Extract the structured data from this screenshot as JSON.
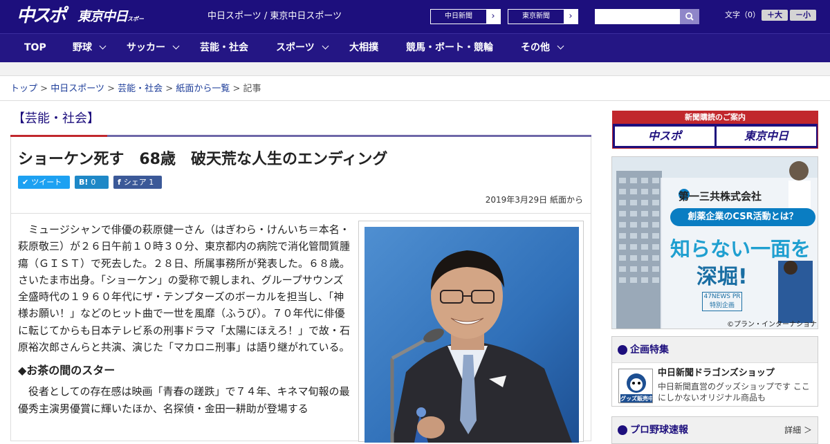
{
  "header": {
    "logo_chuspo": "中スポ",
    "logo_tokyo": "東京中日",
    "logo_tokyo_small": "スポーツ",
    "site_names": "中日スポーツ / 東京中日スポーツ",
    "link_chunichi": "中日新聞",
    "link_tokyo": "東京新聞",
    "fontsize_label": "文字（0）",
    "font_larger": "＋大",
    "font_smaller": "－小",
    "brand_color": "#1d0f7d"
  },
  "nav": {
    "items": [
      {
        "label": "TOP",
        "dropdown": false
      },
      {
        "label": "野球",
        "dropdown": true
      },
      {
        "label": "サッカー",
        "dropdown": true
      },
      {
        "label": "芸能・社会",
        "dropdown": false
      },
      {
        "label": "スポーツ",
        "dropdown": true
      },
      {
        "label": "大相撲",
        "dropdown": false
      },
      {
        "label": "競馬・ボート・競輪",
        "dropdown": false
      },
      {
        "label": "その他",
        "dropdown": true
      }
    ]
  },
  "breadcrumb": {
    "items": [
      "トップ",
      "中日スポーツ",
      "芸能・社会",
      "紙面から一覧"
    ],
    "current": "記事",
    "separator": ">"
  },
  "section": {
    "heading": "【芸能・社会】"
  },
  "article": {
    "title": "ショーケン死す　68歳　破天荒な人生のエンディング",
    "share": {
      "tweet_label": "ツイート",
      "hatena_count": "0",
      "fb_label": "シェア",
      "fb_count": "1"
    },
    "date": "2019年3月29日 紙面から",
    "paragraph1": "ミュージシャンで俳優の萩原健一さん（はぎわら・けんいち＝本名・萩原敬三）が２６日午前１０時３０分、東京都内の病院で消化管間質腫瘍（ＧＩＳＴ）で死去した。２８日、所属事務所が発表した。６８歳。さいたま市出身。「ショーケン」の愛称で親しまれ、グループサウンズ全盛時代の１９６０年代にザ・テンプターズのボーカルを担当し、「神様お願い！」などのヒット曲で一世を風靡（ふうび）。７０年代に俳優に転じてからも日本テレビ系の刑事ドラマ「太陽にほえろ！」で故・石原裕次郎さんらと共演、演じた「マカロニ刑事」は語り継がれている。",
    "subheading": "◆お茶の間のスター",
    "paragraph2": "役者としての存在感は映画「青春の蹉跌」で７４年、キネマ旬報の最優秀主演男優賞に輝いたほか、名探偵・金田一耕助が登場する"
  },
  "sidebar": {
    "subscribe": {
      "header": "新聞購読のご案内",
      "logo1": "中スポ",
      "logo2": "東京中日"
    },
    "ad": {
      "company": "第一三共株式会社",
      "pill": "創薬企業のCSR活動とは？",
      "headline1": "知らない一面を",
      "headline2": "深堀!",
      "badge": "47NEWS PR特別企画",
      "credit": "©プラン・インターナショナル"
    },
    "kikaku": {
      "title": "企画特集",
      "shop_name": "中日新聞ドラゴンズショップ",
      "shop_desc": "中日新聞直営のグッズショップです ここにしかないオリジナル商品も",
      "thumb_text": "グッズ販売中"
    },
    "baseball": {
      "title": "プロ野球速報",
      "more": "詳細 ＞"
    }
  }
}
